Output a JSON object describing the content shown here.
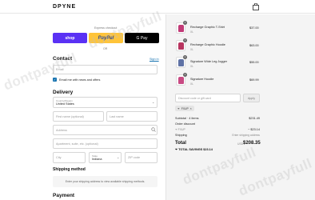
{
  "header": {
    "logo": "DPYNE"
  },
  "express": {
    "label": "Express checkout",
    "shop": "shop",
    "paypal": "PayPal",
    "gpay": "G Pay",
    "or": "OR"
  },
  "contact": {
    "title": "Contact",
    "signin": "Sign in",
    "email_placeholder": "Email",
    "checkbox_label": "Email me with news and offers"
  },
  "delivery": {
    "title": "Delivery",
    "country_label": "Country/Region",
    "country_value": "United States",
    "first_name": "First name (optional)",
    "last_name": "Last name",
    "address": "Address",
    "apartment": "Apartment, suite, etc. (optional)",
    "city": "City",
    "state_label": "State",
    "state_value": "Indiana",
    "zip": "ZIP code"
  },
  "shipping_method": {
    "title": "Shipping method",
    "message": "Enter your shipping address to view available shipping methods."
  },
  "payment": {
    "title": "Payment"
  },
  "cart": {
    "items": [
      {
        "name": "Recharge Graphic T-Shirt",
        "size": "XL",
        "price": "$37.00",
        "qty": "1",
        "color": "#c23a77"
      },
      {
        "name": "Recharge Graphic Hoodie",
        "size": "XL",
        "price": "$63.00",
        "qty": "1",
        "color": "#b8345f"
      },
      {
        "name": "Signature Wide Leg Jogger",
        "size": "XL",
        "price": "$55.00",
        "qty": "1",
        "color": "#5f72a5"
      },
      {
        "name": "Signature Hoodie",
        "size": "XL",
        "price": "$69.99",
        "qty": "1",
        "color": "#c84a83"
      }
    ],
    "discount_placeholder": "Discount code or gift card",
    "apply_label": "Apply",
    "tag_code": "FXUP",
    "subtotal_label": "Subtotal · 4 items",
    "subtotal_value": "$231.49",
    "order_discount_label": "Order discount",
    "discount_code": "FXUP",
    "discount_value": "− $23.14",
    "shipping_label": "Shipping",
    "shipping_value": "Enter shipping address",
    "total_label": "Total",
    "currency": "USD",
    "total_value": "$208.35",
    "savings_label": "TOTAL SAVINGS",
    "savings_value": "$23.14"
  },
  "watermark": "dontpayfull",
  "colors": {
    "accent": "#1773b0",
    "shop_pay": "#5a31f4",
    "paypal": "#ffc439"
  }
}
